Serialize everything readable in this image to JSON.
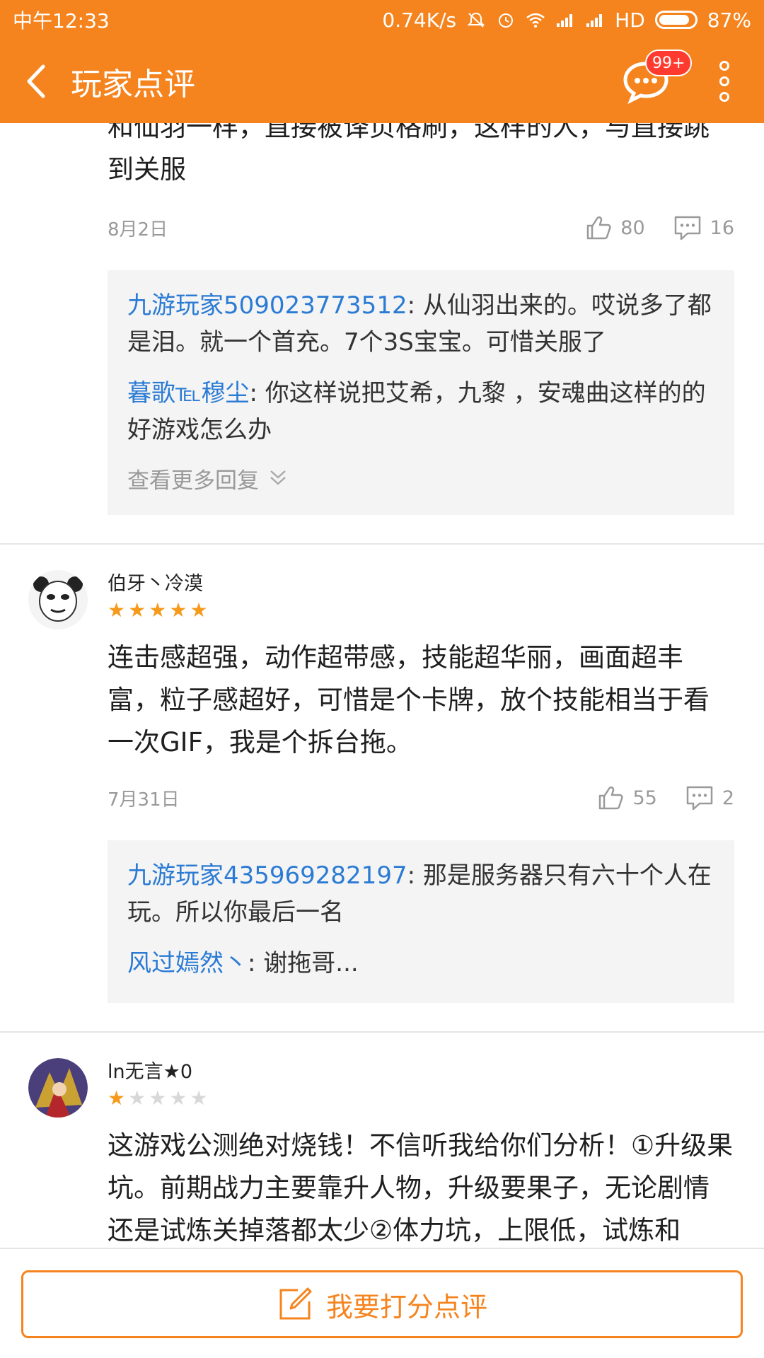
{
  "status_bar": {
    "time": "中午12:33",
    "speed": "0.74K/s",
    "network": "HD",
    "battery": "87%",
    "battery_level": 0.87
  },
  "app_bar": {
    "title": "玩家点评",
    "message_badge": "99+"
  },
  "colors": {
    "accent": "#f5841f",
    "link": "#2b7bd4",
    "star": "#f59a1a",
    "badge": "#ff3b30"
  },
  "reviews": [
    {
      "text_lines": [
        "和仙羽一样，直接被译页格刷，这样的人，与直接跳",
        "到关服"
      ],
      "date": "8月2日",
      "likes": "80",
      "comments": "16",
      "replies": [
        {
          "name": "九游玩家509023773512",
          "text": ": 从仙羽出来的。哎说多了都是泪。就一个首充。7个3S宝宝。可惜关服了"
        },
        {
          "name": "暮歌℡穆尘",
          "text": ": 你这样说把艾希，九黎 ，安魂曲这样的的好游戏怎么办"
        }
      ],
      "more_replies": "查看更多回复"
    },
    {
      "username": "伯牙丶冷漠",
      "rating": 5,
      "text": "连击感超强，动作超带感，技能超华丽，画面超丰富，粒子感超好，可惜是个卡牌，放个技能相当于看一次GIF，我是个拆台拖。",
      "date": "7月31日",
      "likes": "55",
      "comments": "2",
      "replies": [
        {
          "name": "九游玩家435969282197",
          "text": ": 那是服务器只有六十个人在玩。所以你最后一名"
        },
        {
          "name": "风过嫣然丶",
          "text": ": 谢拖哥..."
        }
      ]
    },
    {
      "username": "ln无言★0",
      "rating": 1,
      "text": "这游戏公测绝对烧钱！不信听我给你们分析！①升级果坑。前期战力主要靠升人物，升级要果子，无论剧情还是试炼关掉落都太少②体力坑，上限低，试炼和"
    }
  ],
  "bottom_button": {
    "label": "我要打分点评",
    "icon": "edit-icon"
  }
}
